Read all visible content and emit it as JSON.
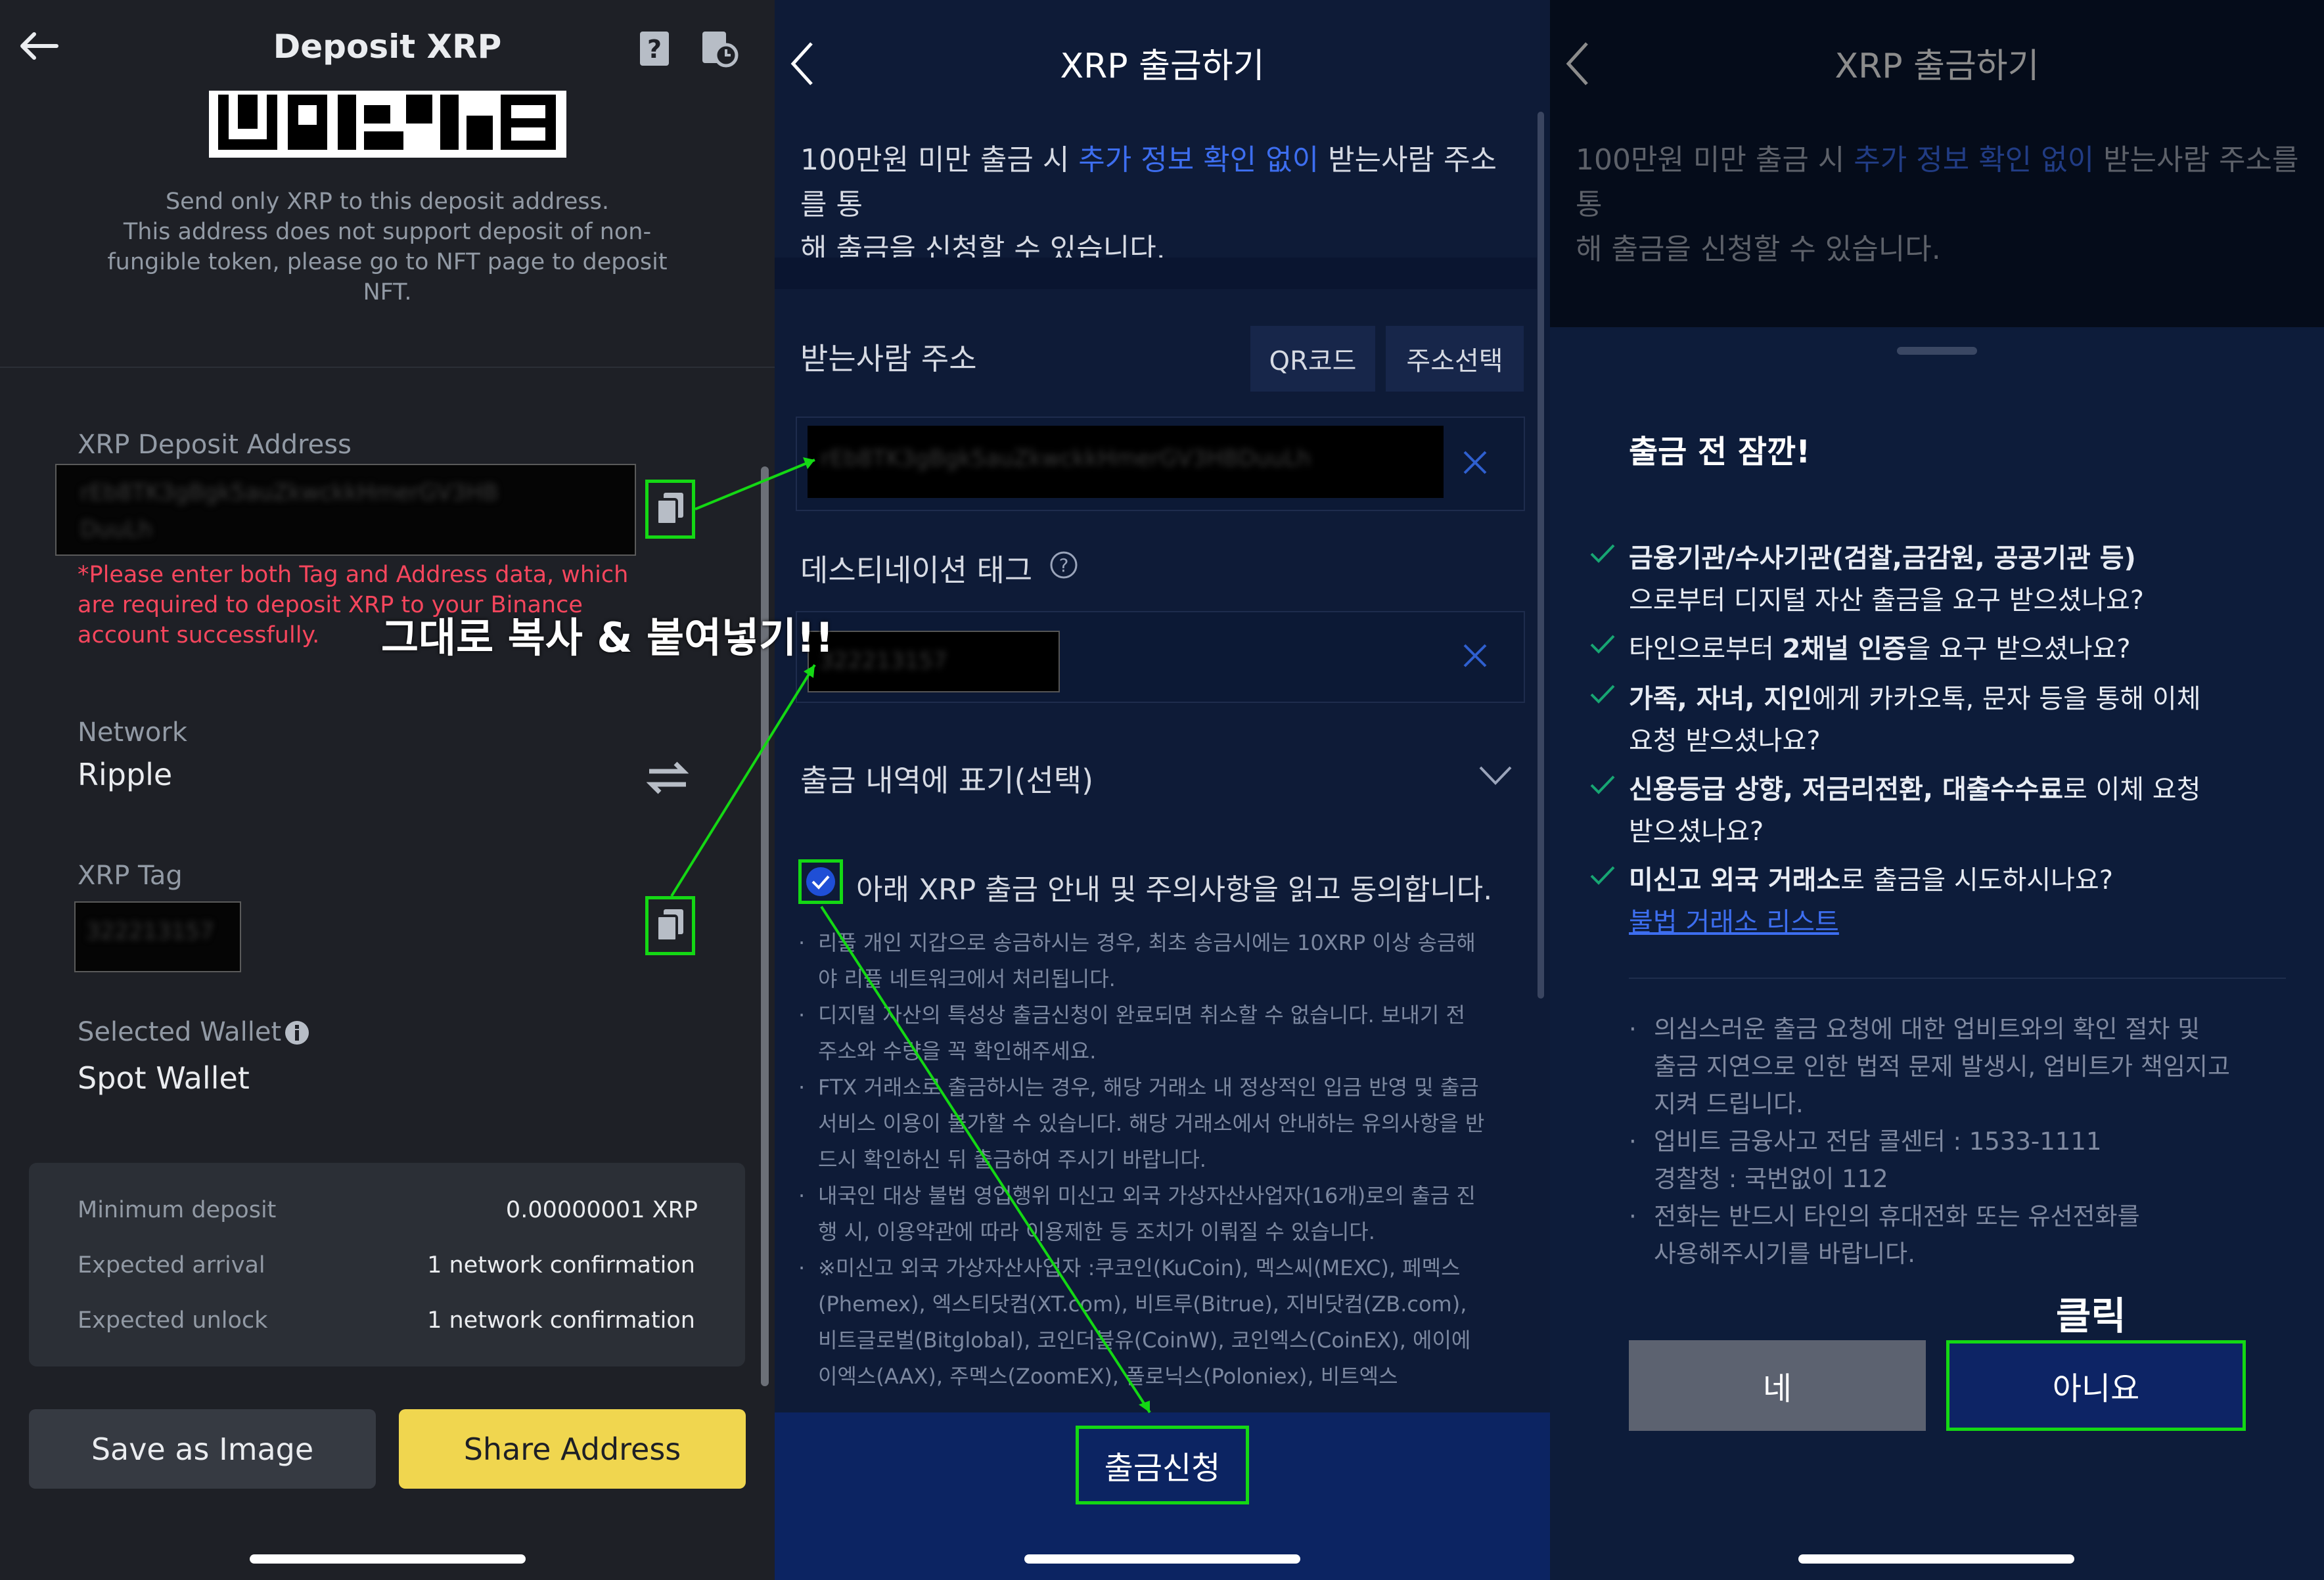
{
  "deposit": {
    "title": "Deposit XRP",
    "notice_line1": "Send only XRP to this deposit address.",
    "notice_line2": "This address does not support deposit of non-",
    "notice_line3": "fungible token, please go to NFT page to deposit",
    "notice_line4": "NFT.",
    "address_label": "XRP Deposit Address",
    "address_value_line1": "rEb8TK3gBgk5auZkwckkHmerGV3HB",
    "address_value_line2": "DuuLh",
    "warning_line1": "*Please enter both Tag and Address data, which",
    "warning_line2": "are required to deposit XRP to your Binance",
    "warning_line3": "account successfully.",
    "network_label": "Network",
    "network_value": "Ripple",
    "tag_label": "XRP Tag",
    "tag_value": "322213157",
    "wallet_label": "Selected Wallet",
    "wallet_value": "Spot Wallet",
    "info": [
      {
        "label": "Minimum deposit",
        "value": "0.00000001 XRP"
      },
      {
        "label": "Expected arrival",
        "value": "1 network confirmation"
      },
      {
        "label": "Expected unlock",
        "value": "1 network confirmation"
      }
    ],
    "save_button": "Save as Image",
    "share_button": "Share Address"
  },
  "annotation": {
    "copy_paste": "그대로 복사 & 붙여넣기!!",
    "click": "클릭"
  },
  "withdraw": {
    "title": "XRP 출금하기",
    "intro_pre": "100만원 미만 출금 시 ",
    "intro_link": "추가 정보 확인 없이",
    "intro_post_line1": " 받는사람 주소를 통",
    "intro_line2": "해 출금을 신청할 수 있습니다.",
    "recipient_label": "받는사람 주소",
    "qr_button": "QR코드",
    "address_select_button": "주소선택",
    "address_value": "rEb8TK3gBgk5auZkwckkHmerGV3HBDuuLh",
    "dest_tag_label": "데스티네이션 태그",
    "dest_tag_value": "322213157",
    "history_label": "출금 내역에 표기(선택)",
    "agree_label": "아래 XRP 출금 안내 및 주의사항을 읽고 동의합니다.",
    "notes": [
      [
        "리플 개인 지갑으로 송금하시는 경우, 최초 송금시에는 10XRP 이상 송금해",
        "야 리플 네트워크에서 처리됩니다."
      ],
      [
        "디지털 자산의 특성상 출금신청이 완료되면 취소할 수 없습니다. 보내기 전",
        "주소와 수량을 꼭 확인해주세요."
      ],
      [
        "FTX 거래소로 출금하시는 경우, 해당 거래소 내 정상적인 입금 반영 및 출금",
        "서비스 이용이 불가할 수 있습니다. 해당 거래소에서 안내하는 유의사항을 반",
        "드시 확인하신 뒤 출금하여 주시기 바랍니다."
      ],
      [
        "내국인 대상 불법 영업행위 미신고 외국 가상자산사업자(16개)로의 출금 진",
        "행 시, 이용약관에 따라 이용제한 등 조치가 이뤄질 수 있습니다."
      ],
      [
        "※미신고 외국 가상자산사업자 :쿠코인(KuCoin), 멕스씨(MEXC), 페멕스",
        "(Phemex), 엑스티닷컴(XT.com), 비트루(Bitrue), 지비닷컴(ZB.com),",
        "비트글로벌(Bitglobal), 코인더블유(CoinW), 코인엑스(CoinEX), 에이에",
        "이엑스(AAX), 주멕스(ZoomEX), 폴로닉스(Poloniex), 비트엑스"
      ]
    ],
    "submit_button": "출금신청"
  },
  "confirm": {
    "heading": "출금 전 잠깐!",
    "items": [
      {
        "bold": "금융기관/수사기관(검찰,금감원, 공공기관 등)",
        "rest": "으로부터 디지털 자산 출금을 요구 받으셨나요?"
      },
      {
        "pre": "타인으로부터 ",
        "bold": "2채널 인증",
        "rest": "을 요구 받으셨나요?"
      },
      {
        "bold": "가족, 자녀, 지인",
        "rest_line1": "에게 카카오톡, 문자 등을 통해 이체",
        "rest_line2": "요청 받으셨나요?"
      },
      {
        "bold": "신용등급 상향, 저금리전환, 대출수수료",
        "rest_line1": "로 이체 요청",
        "rest_line2": "받으셨나요?"
      },
      {
        "bold": "미신고 외국 거래소",
        "rest": "로 출금을 시도하시나요?",
        "link": "불법 거래소 리스트"
      }
    ],
    "notes": [
      [
        "의심스러운 출금 요청에 대한 업비트와의 확인 절차 및",
        "출금 지연으로 인한 법적 문제 발생시, 업비트가 책임지고",
        "지켜 드립니다."
      ],
      [
        "업비트 금융사고 전담 콜센터 : 1533-1111",
        "경찰청 : 국번없이 112"
      ],
      [
        "전화는 반드시 타인의 휴대전화 또는 유선전화를",
        "사용해주시기를 바랍니다."
      ]
    ],
    "yes_button": "네",
    "no_button": "아니요"
  },
  "colors": {
    "binance_bg": "#1e2026",
    "binance_yellow": "#f0d64f",
    "upbit_bg": "#0e1b37",
    "highlight_green": "#14d814",
    "link_blue": "#3d6ef0",
    "warning_red": "#f6465d"
  }
}
